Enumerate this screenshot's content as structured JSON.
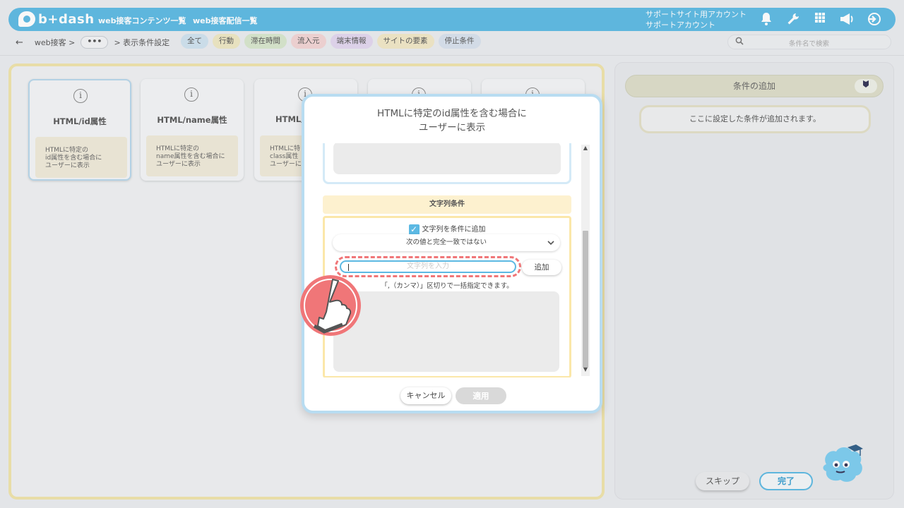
{
  "app": {
    "logo_text": "b+dash",
    "nav_links": [
      "web接客コンテンツ一覧",
      "web接客配信一覧"
    ],
    "account_line1": "サポートサイト用アカウント",
    "account_line2": "サポートアカウント",
    "icons": [
      "bell-icon",
      "wrench-icon",
      "grid-icon",
      "megaphone-icon",
      "logout-icon"
    ]
  },
  "breadcrumb": {
    "back_glyph": "←",
    "root": "web接客 >",
    "more": "•••",
    "current": "> 表示条件設定"
  },
  "filter_tabs": [
    {
      "label": "全て",
      "bg": "#cfe2ee"
    },
    {
      "label": "行動",
      "bg": "#ede7c3"
    },
    {
      "label": "滞在時間",
      "bg": "#d7e6cc"
    },
    {
      "label": "流入元",
      "bg": "#f2d4d4"
    },
    {
      "label": "端末情報",
      "bg": "#e2d6ee"
    },
    {
      "label": "サイトの要素",
      "bg": "#f1e7c6"
    },
    {
      "label": "停止条件",
      "bg": "#d7e1ec"
    }
  ],
  "search": {
    "placeholder": "条件名で検索"
  },
  "cards": [
    {
      "title": "HTML/id属性",
      "desc": [
        "HTMLに特定の",
        "id属性を含む場合に",
        "ユーザーに表示"
      ]
    },
    {
      "title": "HTML/name属性",
      "desc": [
        "HTMLに特定の",
        "name属性を含む場合に",
        "ユーザーに表示"
      ]
    },
    {
      "title": "HTML/",
      "desc": [
        "HTMLに特",
        "class属性",
        "ユーザーに"
      ]
    }
  ],
  "right_panel": {
    "header": "条件の追加",
    "placeholder": "ここに設定した条件が追加されます。",
    "skip": "スキップ",
    "done": "完了"
  },
  "modal": {
    "title_line1": "HTMLに特定のid属性を含む場合に",
    "title_line2": "ユーザーに表示",
    "section_title": "文字列条件",
    "checkbox_label": "文字列を条件に追加",
    "checkbox_checked": true,
    "select_value": "次の値と完全一致ではない",
    "input_placeholder": "文字列を入力",
    "input_value": "",
    "add_button": "追加",
    "hint": "「,（カンマ）」区切りで一括指定できます。",
    "cancel": "キャンセル",
    "apply": "適用"
  }
}
